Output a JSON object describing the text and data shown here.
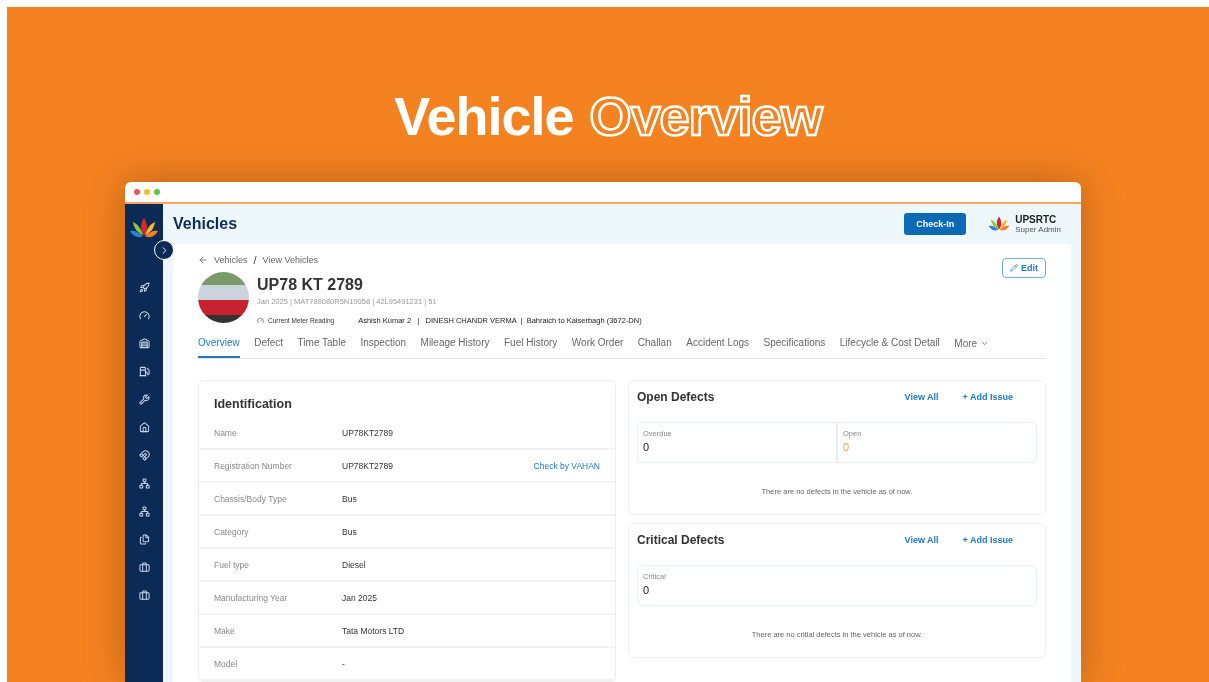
{
  "hero": {
    "title_plain": "Vehicle",
    "title_outline": "Overview"
  },
  "app": {
    "page_title": "Vehicles",
    "checkin": "Check-In",
    "org_name": "UPSRTC",
    "org_role": "Super Admin"
  },
  "breadcrumb": {
    "items": [
      "Vehicles",
      "View Vehicles"
    ],
    "separator": "/"
  },
  "edit": "Edit",
  "vehicle": {
    "plate": "UP78 KT 2789",
    "meta": "Jan 2025 | MAT789080R5N19058 | 42L95491231 | 51",
    "meter_label": "Current Meter Reading",
    "crew": "Ashish Kumar 2   |   DINESH CHANDR VERMA  |  Bahraich to Kaiserbagh (3672-DN)"
  },
  "tabs": [
    {
      "label": "Overview",
      "selected": true
    },
    {
      "label": "Defect",
      "selected": false
    },
    {
      "label": "Time Table",
      "selected": false
    },
    {
      "label": "Inspection",
      "selected": false
    },
    {
      "label": "Mileage History",
      "selected": false
    },
    {
      "label": "Fuel History",
      "selected": false
    },
    {
      "label": "Work Order",
      "selected": false
    },
    {
      "label": "Challan",
      "selected": false
    },
    {
      "label": "Accident Logs",
      "selected": false
    },
    {
      "label": "Specifications",
      "selected": false
    },
    {
      "label": "Lifecycle & Cost Detail",
      "selected": false
    }
  ],
  "more": "More",
  "identification": {
    "title": "Identification",
    "rows": [
      {
        "label": "Name",
        "value": "UP78KT2789"
      },
      {
        "label": "Registration Number",
        "value": "UP78KT2789",
        "action": "Check by VAHAN"
      },
      {
        "label": "Chassis/Body Type",
        "value": "Bus"
      },
      {
        "label": "Category",
        "value": "Bus"
      },
      {
        "label": "Fuel type",
        "value": "Diesel"
      },
      {
        "label": "Manufacturing Year",
        "value": "Jan 2025"
      },
      {
        "label": "Make",
        "value": "Tata Motors LTD"
      },
      {
        "label": "Model",
        "value": "-"
      }
    ]
  },
  "defect_panels": [
    {
      "title": "Open Defects",
      "view_all": "View All",
      "add": "+ Add Issue",
      "stats": [
        {
          "label": "Overdue",
          "value": "0",
          "highlighted": false
        },
        {
          "label": "Open",
          "value": "0",
          "highlighted": true
        }
      ],
      "empty": "There are no defects in the vehicle as of now."
    },
    {
      "title": "Critical Defects",
      "view_all": "View All",
      "add": "+ Add Issue",
      "stats": [
        {
          "label": "Critical",
          "value": "0",
          "highlighted": false
        }
      ],
      "empty": "There are no critial defects in the vehicle as of now."
    }
  ]
}
